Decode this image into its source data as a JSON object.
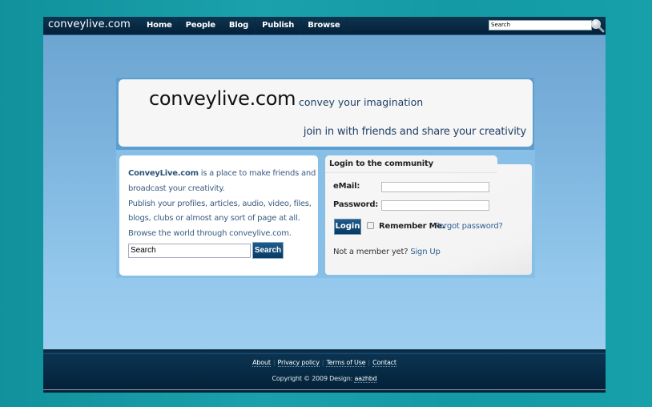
{
  "header": {
    "logo": "conveylive.com",
    "nav": [
      "Home",
      "People",
      "Blog",
      "Publish",
      "Browse"
    ],
    "search_placeholder": "Search",
    "search_value": "Search",
    "search_icon": "magnifier-icon"
  },
  "banner": {
    "title": "conveylive.com",
    "tagline": "convey your imagination",
    "subtitle": "join in with friends and share your creativity"
  },
  "intro": {
    "brand": "ConveyLive.com",
    "lines": [
      " is a place to make friends and",
      "broadcast your creativity.",
      "Publish your profiles, articles, audio, video, files,",
      "blogs, clubs or almost any sort of page at all.",
      "Browse the world through conveylive.com."
    ],
    "search_value": "Search",
    "search_button": "Search"
  },
  "login": {
    "title": "Login to the community",
    "email_label": "eMail:",
    "email_value": "",
    "password_label": "Password:",
    "password_value": "",
    "login_button": "Login",
    "remember_label": "Remember Me.",
    "remember_checked": false,
    "forgot_link": "Forgot password?",
    "not_member_text": "Not a member yet?",
    "signup_link": "Sign Up"
  },
  "footer": {
    "links": [
      "About",
      "Privacy policy",
      "Terms of Use",
      "Contact"
    ],
    "copyright": "Copyright © 2009 Design: ",
    "designer": "aazhbd"
  },
  "colors": {
    "accent_dark": "#063a63",
    "link": "#2e6294",
    "background": "#1aa1ab"
  }
}
